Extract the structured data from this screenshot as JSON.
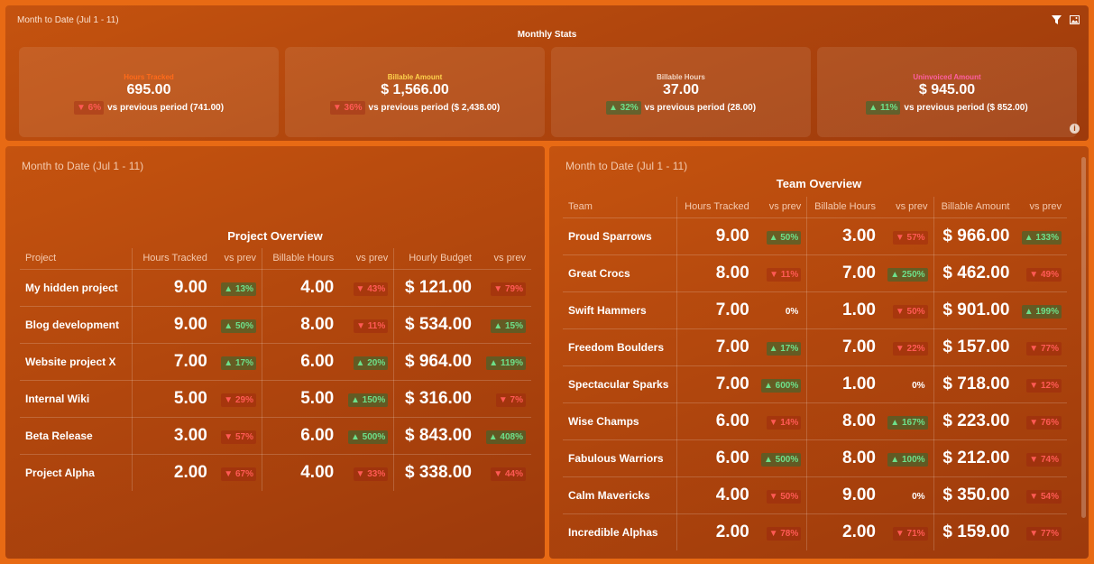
{
  "top": {
    "period": "Month to Date (Jul 1 - 11)",
    "title": "Monthly Stats",
    "icons": [
      "filter-icon",
      "image-icon",
      "info-icon"
    ],
    "info_glyph": "i",
    "kpis": [
      {
        "label": "Hours Tracked",
        "label_color": "#ff6a1a",
        "value": "695.00",
        "delta": "▼ 6%",
        "direction": "down",
        "compare": "vs previous period (741.00)"
      },
      {
        "label": "Billable Amount",
        "label_color": "#ffd34d",
        "value": "$ 1,566.00",
        "delta": "▼ 36%",
        "direction": "down",
        "compare": "vs previous period ($ 2,438.00)"
      },
      {
        "label": "Billable Hours",
        "label_color": "#f2d6c3",
        "value": "37.00",
        "delta": "▲ 32%",
        "direction": "up",
        "compare": "vs previous period (28.00)"
      },
      {
        "label": "Uninvoiced Amount",
        "label_color": "#ff5fa2",
        "value": "$ 945.00",
        "delta": "▲ 11%",
        "direction": "up",
        "compare": "vs previous period ($ 852.00)"
      }
    ]
  },
  "project": {
    "period": "Month to Date (Jul 1 - 11)",
    "title": "Project Overview",
    "headers": [
      "Project",
      "Hours Tracked",
      "vs prev",
      "Billable Hours",
      "vs prev",
      "Hourly Budget",
      "vs prev"
    ],
    "rows": [
      {
        "name": "My hidden project",
        "hours": "9.00",
        "hours_delta": "▲ 13%",
        "hours_dir": "up",
        "billable": "4.00",
        "billable_delta": "▼ 43%",
        "billable_dir": "down",
        "budget": "$ 121.00",
        "budget_delta": "▼ 79%",
        "budget_dir": "down"
      },
      {
        "name": "Blog development",
        "hours": "9.00",
        "hours_delta": "▲ 50%",
        "hours_dir": "up",
        "billable": "8.00",
        "billable_delta": "▼ 11%",
        "billable_dir": "down",
        "budget": "$ 534.00",
        "budget_delta": "▲ 15%",
        "budget_dir": "up"
      },
      {
        "name": "Website project X",
        "hours": "7.00",
        "hours_delta": "▲ 17%",
        "hours_dir": "up",
        "billable": "6.00",
        "billable_delta": "▲ 20%",
        "billable_dir": "up",
        "budget": "$ 964.00",
        "budget_delta": "▲ 119%",
        "budget_dir": "up"
      },
      {
        "name": "Internal Wiki",
        "hours": "5.00",
        "hours_delta": "▼ 29%",
        "hours_dir": "down",
        "billable": "5.00",
        "billable_delta": "▲ 150%",
        "billable_dir": "up",
        "budget": "$ 316.00",
        "budget_delta": "▼ 7%",
        "budget_dir": "down"
      },
      {
        "name": "Beta Release",
        "hours": "3.00",
        "hours_delta": "▼ 57%",
        "hours_dir": "down",
        "billable": "6.00",
        "billable_delta": "▲ 500%",
        "billable_dir": "up",
        "budget": "$ 843.00",
        "budget_delta": "▲ 408%",
        "budget_dir": "up"
      },
      {
        "name": "Project Alpha",
        "hours": "2.00",
        "hours_delta": "▼ 67%",
        "hours_dir": "down",
        "billable": "4.00",
        "billable_delta": "▼ 33%",
        "billable_dir": "down",
        "budget": "$ 338.00",
        "budget_delta": "▼ 44%",
        "budget_dir": "down"
      }
    ]
  },
  "team": {
    "period": "Month to Date (Jul 1 - 11)",
    "title": "Team Overview",
    "headers": [
      "Team",
      "Hours Tracked",
      "vs prev",
      "Billable Hours",
      "vs prev",
      "Billable Amount",
      "vs prev"
    ],
    "rows": [
      {
        "name": "Proud Sparrows",
        "hours": "9.00",
        "hours_delta": "▲ 50%",
        "hours_dir": "up",
        "billable": "3.00",
        "billable_delta": "▼ 57%",
        "billable_dir": "down",
        "amount": "$ 966.00",
        "amount_delta": "▲ 133%",
        "amount_dir": "up"
      },
      {
        "name": "Great Crocs",
        "hours": "8.00",
        "hours_delta": "▼ 11%",
        "hours_dir": "down",
        "billable": "7.00",
        "billable_delta": "▲ 250%",
        "billable_dir": "up",
        "amount": "$ 462.00",
        "amount_delta": "▼ 49%",
        "amount_dir": "down"
      },
      {
        "name": "Swift Hammers",
        "hours": "7.00",
        "hours_delta": "0%",
        "hours_dir": "zero",
        "billable": "1.00",
        "billable_delta": "▼ 50%",
        "billable_dir": "down",
        "amount": "$ 901.00",
        "amount_delta": "▲ 199%",
        "amount_dir": "up"
      },
      {
        "name": "Freedom Boulders",
        "hours": "7.00",
        "hours_delta": "▲ 17%",
        "hours_dir": "up",
        "billable": "7.00",
        "billable_delta": "▼ 22%",
        "billable_dir": "down",
        "amount": "$ 157.00",
        "amount_delta": "▼ 77%",
        "amount_dir": "down"
      },
      {
        "name": "Spectacular Sparks",
        "hours": "7.00",
        "hours_delta": "▲ 600%",
        "hours_dir": "up",
        "billable": "1.00",
        "billable_delta": "0%",
        "billable_dir": "zero",
        "amount": "$ 718.00",
        "amount_delta": "▼ 12%",
        "amount_dir": "down"
      },
      {
        "name": "Wise Champs",
        "hours": "6.00",
        "hours_delta": "▼ 14%",
        "hours_dir": "down",
        "billable": "8.00",
        "billable_delta": "▲ 167%",
        "billable_dir": "up",
        "amount": "$ 223.00",
        "amount_delta": "▼ 76%",
        "amount_dir": "down"
      },
      {
        "name": "Fabulous Warriors",
        "hours": "6.00",
        "hours_delta": "▲ 500%",
        "hours_dir": "up",
        "billable": "8.00",
        "billable_delta": "▲ 100%",
        "billable_dir": "up",
        "amount": "$ 212.00",
        "amount_delta": "▼ 74%",
        "amount_dir": "down"
      },
      {
        "name": "Calm Mavericks",
        "hours": "4.00",
        "hours_delta": "▼ 50%",
        "hours_dir": "down",
        "billable": "9.00",
        "billable_delta": "0%",
        "billable_dir": "zero",
        "amount": "$ 350.00",
        "amount_delta": "▼ 54%",
        "amount_dir": "down"
      },
      {
        "name": "Incredible Alphas",
        "hours": "2.00",
        "hours_delta": "▼ 78%",
        "hours_dir": "down",
        "billable": "2.00",
        "billable_delta": "▼ 71%",
        "billable_dir": "down",
        "amount": "$ 159.00",
        "amount_delta": "▼ 77%",
        "amount_dir": "down"
      }
    ]
  }
}
